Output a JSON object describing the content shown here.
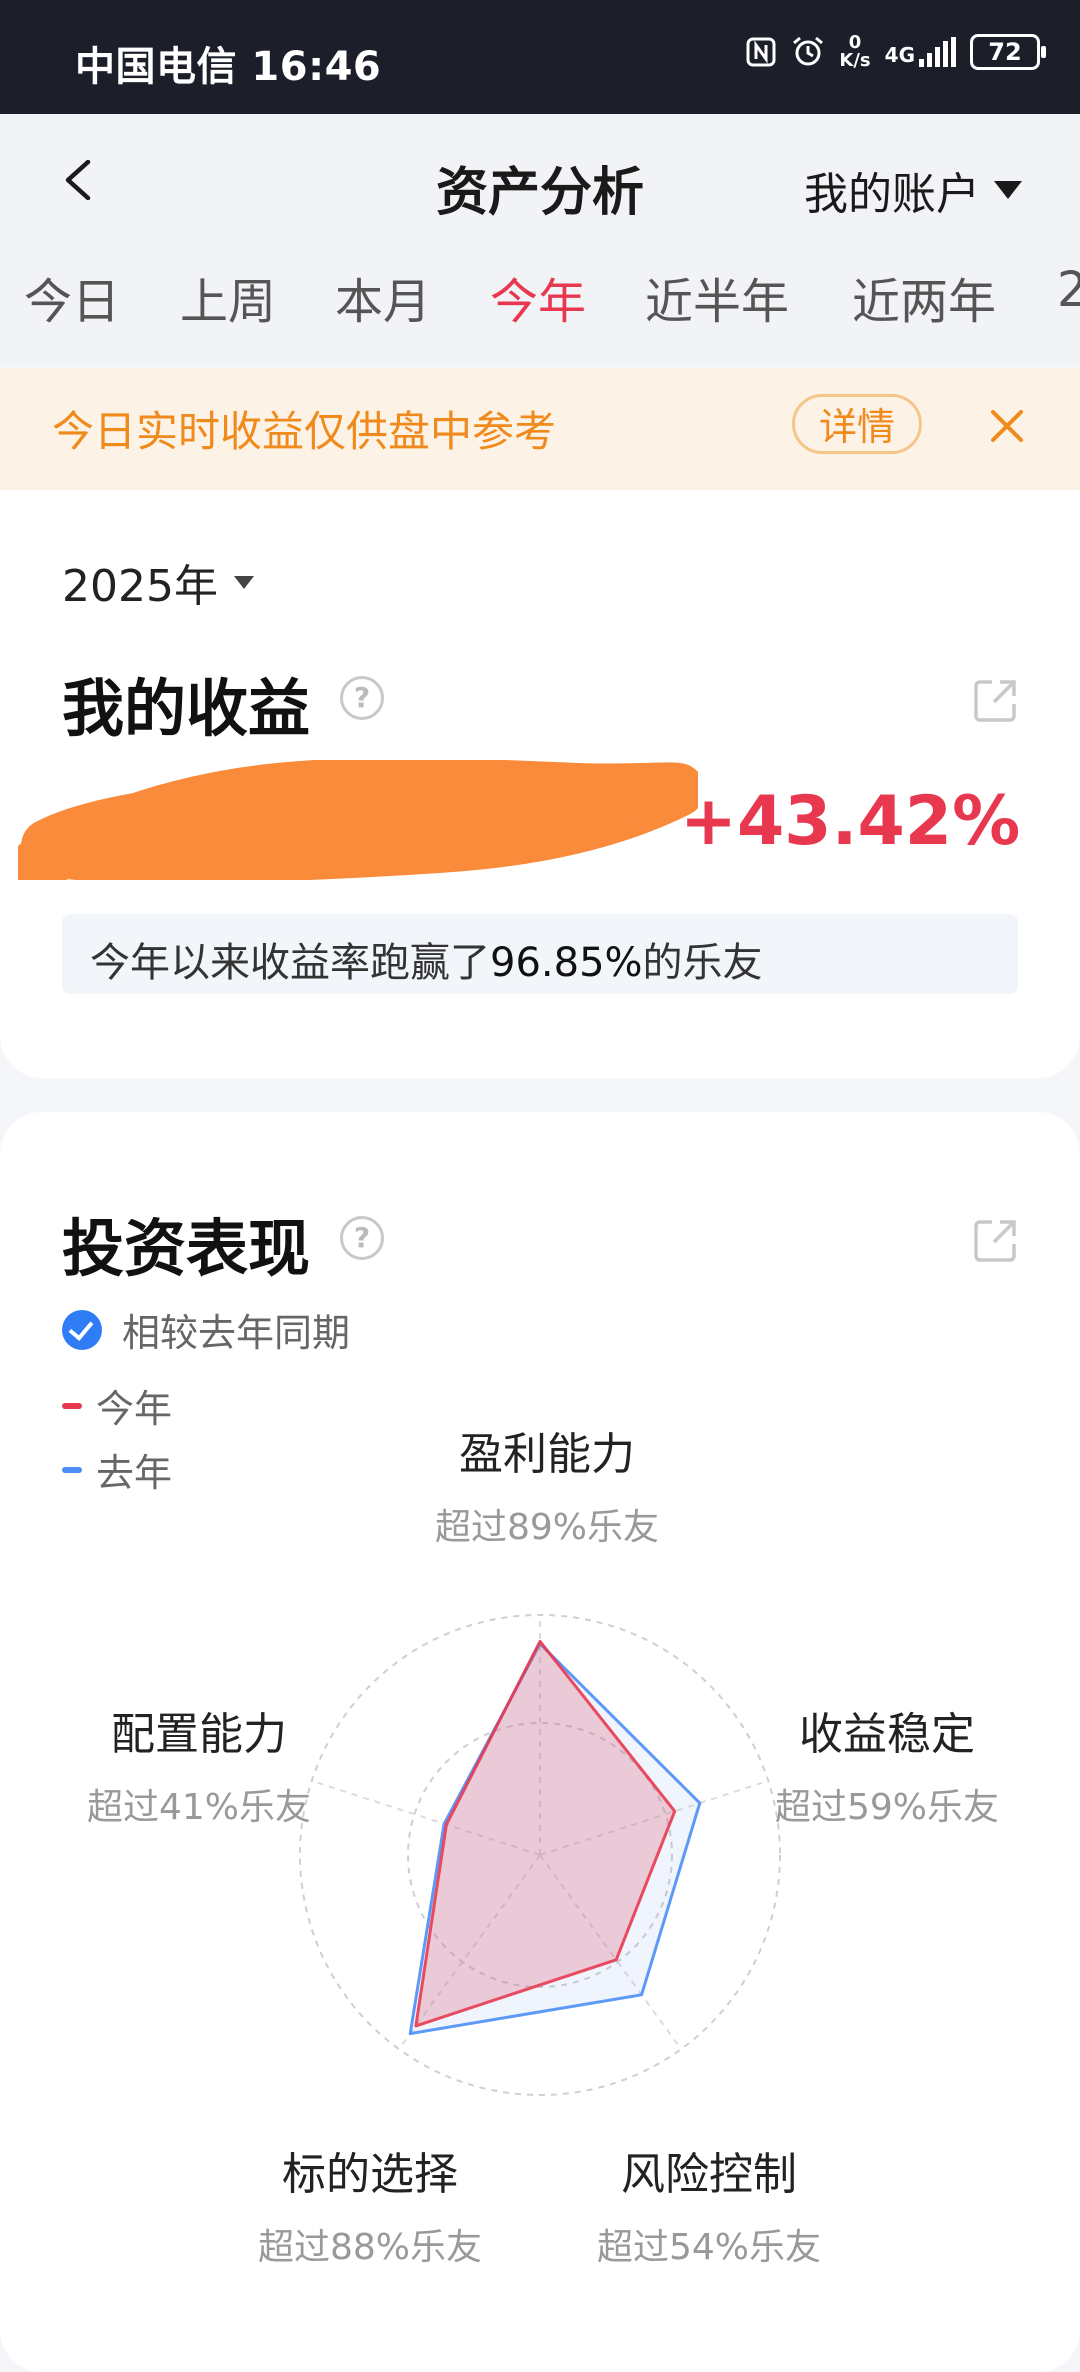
{
  "status_bar": {
    "carrier_time": "中国电信 16:46",
    "net_speed": "0\nK/s",
    "network": "4G",
    "battery": "72",
    "icons": [
      "nfc-icon",
      "alarm-icon",
      "signal-icon",
      "battery-icon"
    ]
  },
  "header": {
    "title": "资产分析",
    "account": "我的账户",
    "back_icon": "chevron-left-icon"
  },
  "tabs": [
    {
      "label": "今日",
      "active": false
    },
    {
      "label": "上周",
      "active": false
    },
    {
      "label": "本月",
      "active": false
    },
    {
      "label": "今年",
      "active": true
    },
    {
      "label": "近半年",
      "active": false
    },
    {
      "label": "近两年",
      "active": false
    },
    {
      "label": "2",
      "active": false
    }
  ],
  "notice": {
    "text": "今日实时收益仅供盘中参考",
    "button": "详情"
  },
  "earnings": {
    "year": "2025年",
    "title": "我的收益",
    "percent": "+43.42%",
    "rank_prefix": "今年以来收益率跑赢了",
    "rank_value": "96.85%",
    "rank_suffix": "的乐友"
  },
  "performance": {
    "title": "投资表现",
    "compare_label": "相较去年同期",
    "legend": [
      {
        "label": "今年",
        "color": "#e8384f"
      },
      {
        "label": "去年",
        "color": "#4c8ef7"
      }
    ],
    "axes": [
      {
        "name": "盈利能力",
        "sub": "超过89%乐友"
      },
      {
        "name": "收益稳定",
        "sub": "超过59%乐友"
      },
      {
        "name": "风险控制",
        "sub": "超过54%乐友"
      },
      {
        "name": "标的选择",
        "sub": "超过88%乐友"
      },
      {
        "name": "配置能力",
        "sub": "超过41%乐友"
      }
    ],
    "series": [
      {
        "name": "今年",
        "values": [
          89,
          59,
          54,
          88,
          41
        ],
        "color": "#e8384f"
      },
      {
        "name": "去年",
        "values": [
          88,
          70,
          72,
          92,
          42
        ],
        "color": "#4c8ef7"
      }
    ]
  },
  "colors": {
    "accent": "#e8384f",
    "notice_text": "#f08a1c",
    "notice_bg": "#fdf2e6",
    "blue": "#2e7cf6"
  }
}
